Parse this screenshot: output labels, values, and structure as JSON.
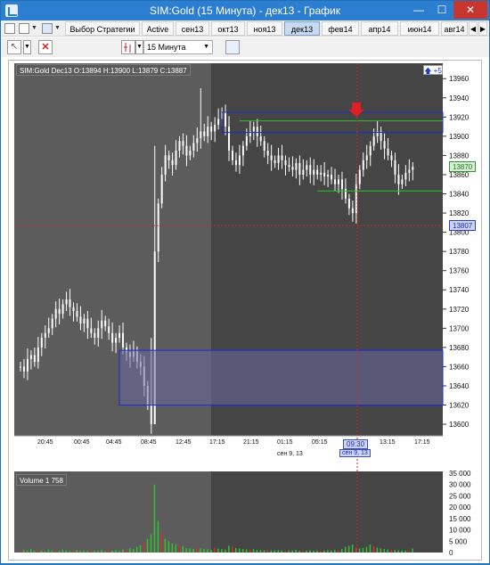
{
  "window": {
    "title": "SIM:Gold (15 Минута) - дек13 - График",
    "minimize": "—",
    "maximize": "☐",
    "close": "✕"
  },
  "toolbar1": {
    "strategy_label": "Выбор Стратегии",
    "active_label": "Active",
    "contract_tabs": [
      "сен13",
      "окт13",
      "ноя13",
      "дек13",
      "фев14",
      "апр14",
      "июн14",
      "авг14"
    ],
    "selected_contract": "дек13"
  },
  "toolbar2": {
    "interval": "15 Минута",
    "delete_icon": "x-icon"
  },
  "legend": {
    "text": "SIM:Gold Dec13 O:13894 H:13900 L:13879 C:13887",
    "corner": "+5"
  },
  "price_tags": {
    "current": "13870",
    "crosshair": "13807"
  },
  "time_axis": {
    "labels": [
      "20:45",
      "00:45",
      "04:45",
      "08:45",
      "12:45",
      "17:15",
      "21:15",
      "01:15",
      "05:15",
      "09:30",
      "13:15",
      "17:15"
    ],
    "date_left": "сен 9, 13",
    "date_cross": "сен 9, 13",
    "cross_time": "09:30"
  },
  "volume": {
    "legend": "Volume 1 758",
    "ticks": [
      "35 000",
      "30 000",
      "25 000",
      "20 000",
      "15 000",
      "10 000",
      "5 000",
      "0"
    ]
  },
  "colors": {
    "chart_bg": "#5c5c5c",
    "chart_bg_dark": "#454545",
    "candle": "#ffffff",
    "zone_border": "#1d2bd0",
    "zone_fill": "#6a6aa0",
    "green_line": "#2cc12c",
    "crosshair": "#c0302a",
    "marker": "#e02020"
  },
  "chart_data": {
    "type": "candlestick",
    "symbol": "SIM:Gold Dec13",
    "ohlc_last": {
      "O": 13894,
      "H": 13900,
      "L": 13879,
      "C": 13887
    },
    "y_ticks": [
      13600,
      13620,
      13640,
      13660,
      13680,
      13700,
      13720,
      13740,
      13760,
      13780,
      13800,
      13820,
      13840,
      13860,
      13880,
      13900,
      13920,
      13940,
      13960
    ],
    "ylim": [
      13588,
      13976
    ],
    "closes": [
      13660,
      13655,
      13668,
      13672,
      13665,
      13680,
      13690,
      13695,
      13700,
      13710,
      13720,
      13715,
      13725,
      13730,
      13722,
      13718,
      13712,
      13705,
      13710,
      13700,
      13695,
      13690,
      13700,
      13708,
      13702,
      13695,
      13685,
      13690,
      13695,
      13680,
      13675,
      13670,
      13676,
      13665,
      13660,
      13640,
      13620,
      13600,
      13780,
      13830,
      13860,
      13880,
      13875,
      13870,
      13885,
      13895,
      13890,
      13880,
      13885,
      13893,
      13898,
      13905,
      13900,
      13910,
      13905,
      13912,
      13918,
      13925,
      13910,
      13885,
      13875,
      13870,
      13880,
      13890,
      13900,
      13905,
      13910,
      13900,
      13895,
      13885,
      13880,
      13875,
      13872,
      13880,
      13875,
      13870,
      13868,
      13865,
      13872,
      13860,
      13865,
      13870,
      13860,
      13865,
      13860,
      13862,
      13858,
      13860,
      13855,
      13850,
      13855,
      13845,
      13835,
      13825,
      13820,
      13850,
      13865,
      13875,
      13880,
      13890,
      13900,
      13905,
      13895,
      13887,
      13880,
      13875,
      13860,
      13850,
      13855,
      13862,
      13865,
      13868
    ],
    "zones": [
      {
        "top": 13925,
        "bottom": 13904
      },
      {
        "top": 13677,
        "bottom": 13620
      }
    ],
    "green_level": 13843,
    "volume_ylim": [
      0,
      35000
    ],
    "volumes": [
      900,
      1200,
      800,
      1500,
      700,
      1100,
      900,
      600,
      1300,
      800,
      1000,
      700,
      1200,
      900,
      600,
      800,
      1100,
      700,
      900,
      600,
      1000,
      800,
      700,
      1200,
      600,
      900,
      800,
      1100,
      700,
      1300,
      900,
      2000,
      1500,
      2500,
      3200,
      4500,
      6000,
      8000,
      30000,
      14000,
      9000,
      6000,
      5000,
      4000,
      3500,
      3000,
      2800,
      2000,
      1800,
      1500,
      2200,
      1800,
      1600,
      1400,
      1200,
      2000,
      1700,
      1500,
      1300,
      3000,
      2500,
      2000,
      1800,
      1600,
      1400,
      1300,
      1500,
      1200,
      1100,
      1000,
      1200,
      900,
      1000,
      1100,
      900,
      800,
      1000,
      900,
      1200,
      800,
      700,
      900,
      1000,
      800,
      900,
      700,
      800,
      1000,
      900,
      1200,
      1000,
      1500,
      2500,
      3000,
      3500,
      2200,
      1800,
      2000,
      2500,
      3500,
      2800,
      2200,
      1800,
      1500,
      1300,
      1200,
      1100,
      1000,
      900,
      800,
      700,
      1758
    ]
  }
}
